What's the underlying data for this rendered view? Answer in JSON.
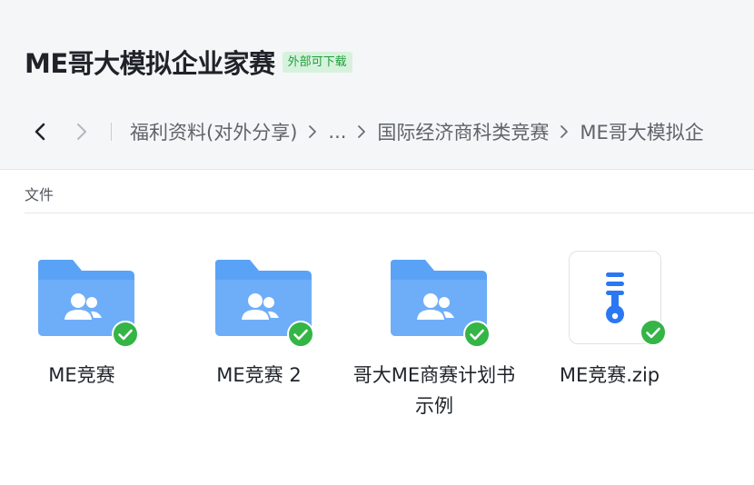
{
  "header": {
    "title": "ME哥大模拟企业家赛",
    "badge": "外部可下载"
  },
  "breadcrumb": {
    "items": [
      "福利资料(对外分享)",
      "...",
      "国际经济商科类竞赛",
      "ME哥大模拟企"
    ]
  },
  "section": {
    "label": "文件"
  },
  "files": [
    {
      "name": "ME竞赛",
      "type": "folder",
      "synced": true
    },
    {
      "name": "ME竞赛 2",
      "type": "folder",
      "synced": true
    },
    {
      "name": "哥大ME商赛计划书示例",
      "type": "folder",
      "synced": true
    },
    {
      "name": "ME竞赛.zip",
      "type": "zip",
      "synced": true
    }
  ],
  "icons": {
    "back": "chevron-left-icon",
    "forward": "chevron-right-icon",
    "folder": "shared-folder-icon",
    "zip": "zip-file-icon",
    "synced": "check-circle-icon"
  },
  "colors": {
    "folder": "#5aa2f6",
    "badge_bg": "#d6f2dc",
    "badge_text": "#1f9e3c",
    "check": "#34b546",
    "zip_accent": "#2b77f3"
  }
}
